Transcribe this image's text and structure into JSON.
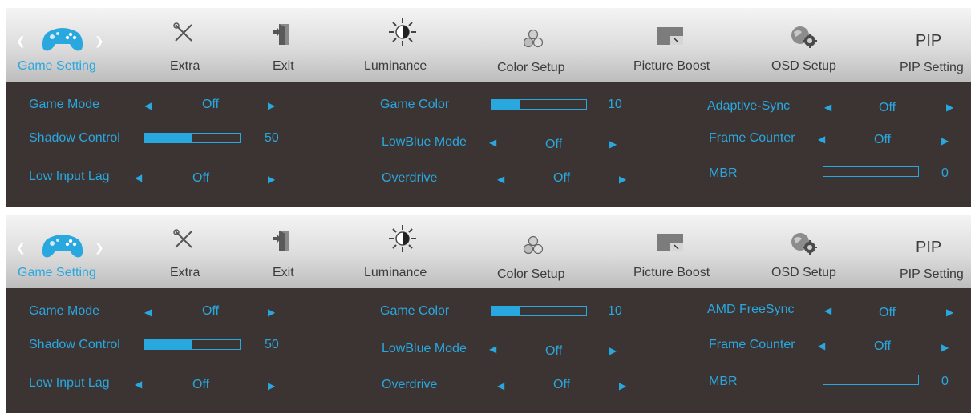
{
  "colors": {
    "accent": "#29a8e0",
    "tab_bg": "#d8d8d8",
    "content_bg": "#3b3433",
    "tab_text": "#3c3c3c"
  },
  "panels": [
    {
      "tabs": [
        {
          "label": "Game Setting",
          "icon": "gamepad-icon"
        },
        {
          "label": "Extra",
          "icon": "tools-icon"
        },
        {
          "label": "Exit",
          "icon": "exit-door-icon"
        },
        {
          "label": "Luminance",
          "icon": "sun-icon"
        },
        {
          "label": "Color Setup",
          "icon": "color-circles-icon"
        },
        {
          "label": "Picture Boost",
          "icon": "picture-boost-icon"
        },
        {
          "label": "OSD Setup",
          "icon": "globe-gear-icon"
        },
        {
          "label": "PIP Setting",
          "icon_text": "PIP"
        }
      ],
      "settings": {
        "game_mode": {
          "label": "Game Mode",
          "value": "Off"
        },
        "shadow_control": {
          "label": "Shadow Control",
          "value": "50",
          "level": 0.5
        },
        "low_input_lag": {
          "label": "Low Input Lag",
          "value": "Off"
        },
        "game_color": {
          "label": "Game Color",
          "value": "10",
          "level": 0.3
        },
        "lowblue_mode": {
          "label": "LowBlue Mode",
          "value": "Off"
        },
        "overdrive": {
          "label": "Overdrive",
          "value": "Off"
        },
        "sync": {
          "label": "Adaptive-Sync",
          "value": "Off"
        },
        "frame_counter": {
          "label": "Frame Counter",
          "value": "Off"
        },
        "mbr": {
          "label": "MBR",
          "value": "0",
          "level": 0
        }
      }
    },
    {
      "tabs": [
        {
          "label": "Game Setting",
          "icon": "gamepad-icon"
        },
        {
          "label": "Extra",
          "icon": "tools-icon"
        },
        {
          "label": "Exit",
          "icon": "exit-door-icon"
        },
        {
          "label": "Luminance",
          "icon": "sun-icon"
        },
        {
          "label": "Color Setup",
          "icon": "color-circles-icon"
        },
        {
          "label": "Picture Boost",
          "icon": "picture-boost-icon"
        },
        {
          "label": "OSD Setup",
          "icon": "globe-gear-icon"
        },
        {
          "label": "PIP Setting",
          "icon_text": "PIP"
        }
      ],
      "settings": {
        "game_mode": {
          "label": "Game Mode",
          "value": "Off"
        },
        "shadow_control": {
          "label": "Shadow Control",
          "value": "50",
          "level": 0.5
        },
        "low_input_lag": {
          "label": "Low Input Lag",
          "value": "Off"
        },
        "game_color": {
          "label": "Game Color",
          "value": "10",
          "level": 0.3
        },
        "lowblue_mode": {
          "label": "LowBlue Mode",
          "value": "Off"
        },
        "overdrive": {
          "label": "Overdrive",
          "value": "Off"
        },
        "sync": {
          "label": "AMD FreeSync",
          "value": "Off"
        },
        "frame_counter": {
          "label": "Frame Counter",
          "value": "Off"
        },
        "mbr": {
          "label": "MBR",
          "value": "0",
          "level": 0
        }
      }
    }
  ]
}
